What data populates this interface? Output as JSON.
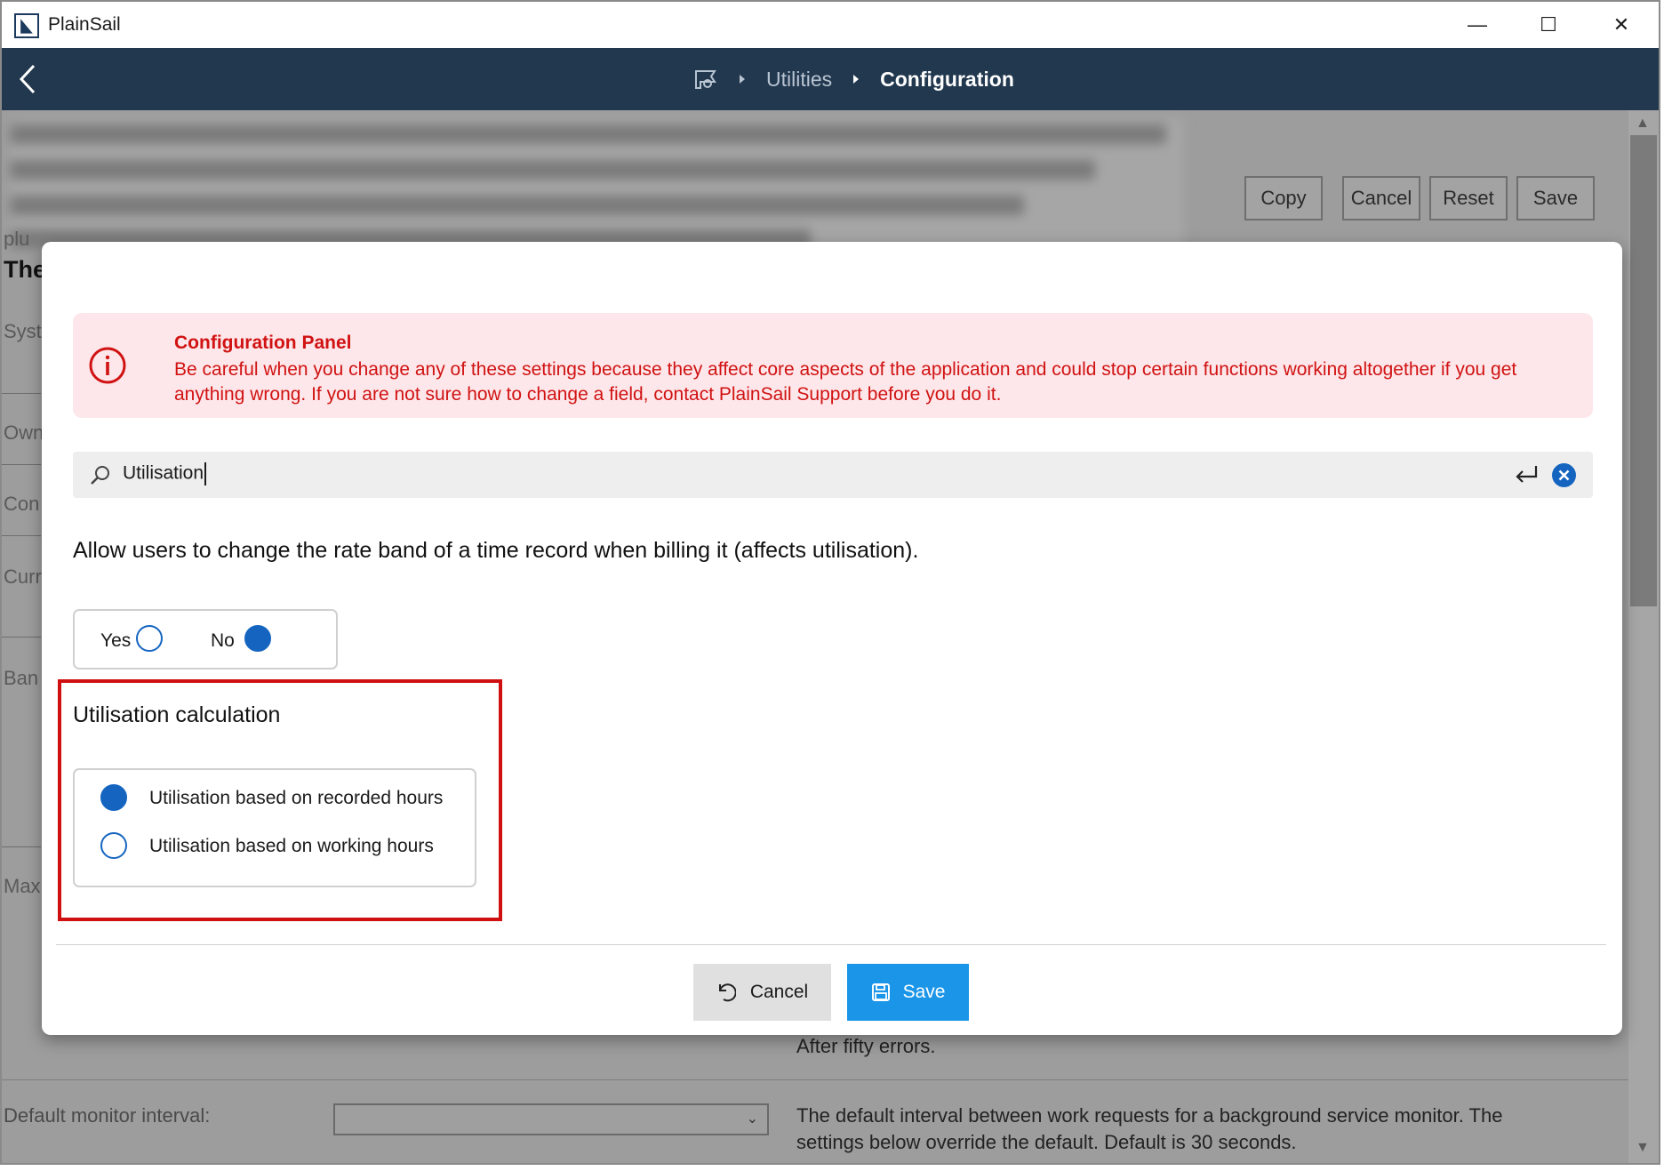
{
  "window": {
    "app_name": "PlainSail",
    "minimize_glyph": "—",
    "maximize_glyph": "☐",
    "close_glyph": "✕"
  },
  "breadcrumb": {
    "home_icon": "home-flag-icon",
    "items": [
      "Utilities",
      "Configuration"
    ]
  },
  "background": {
    "toolbar": [
      "Copy",
      "Cancel",
      "Reset",
      "Save"
    ],
    "side_labels": [
      "plu",
      "The",
      "Syst",
      "Own",
      "Con",
      "Curr",
      "Ban",
      "Max"
    ],
    "after_text": "After fifty errors.",
    "monitor_label": "Default monitor interval:",
    "monitor_desc_1": "The default interval between work requests for a background service monitor. The",
    "monitor_desc_2": "settings below override the default. Default is 30 seconds."
  },
  "alert": {
    "title": "Configuration Panel",
    "body": "Be careful when you change any of these settings because they affect core aspects of the application and could stop certain functions working altogether if you get anything wrong. If you are not sure how to change a field, contact PlainSail Support before you do it.",
    "color": "#d11212"
  },
  "search": {
    "value": "Utilisation"
  },
  "setting_rate_band": {
    "question": "Allow users to change the rate band of a time record when billing it (affects utilisation).",
    "options": [
      {
        "label": "Yes",
        "selected": false
      },
      {
        "label": "No",
        "selected": true
      }
    ]
  },
  "utilisation": {
    "title": "Utilisation calculation",
    "options": [
      {
        "label": "Utilisation based on recorded hours",
        "selected": true
      },
      {
        "label": "Utilisation based on working hours",
        "selected": false
      }
    ]
  },
  "actions": {
    "cancel_label": "Cancel",
    "save_label": "Save",
    "save_color": "#1a95e8"
  },
  "colors": {
    "nav_bg": "#22384f",
    "accent": "#1565c0",
    "highlight": "#d01010"
  }
}
